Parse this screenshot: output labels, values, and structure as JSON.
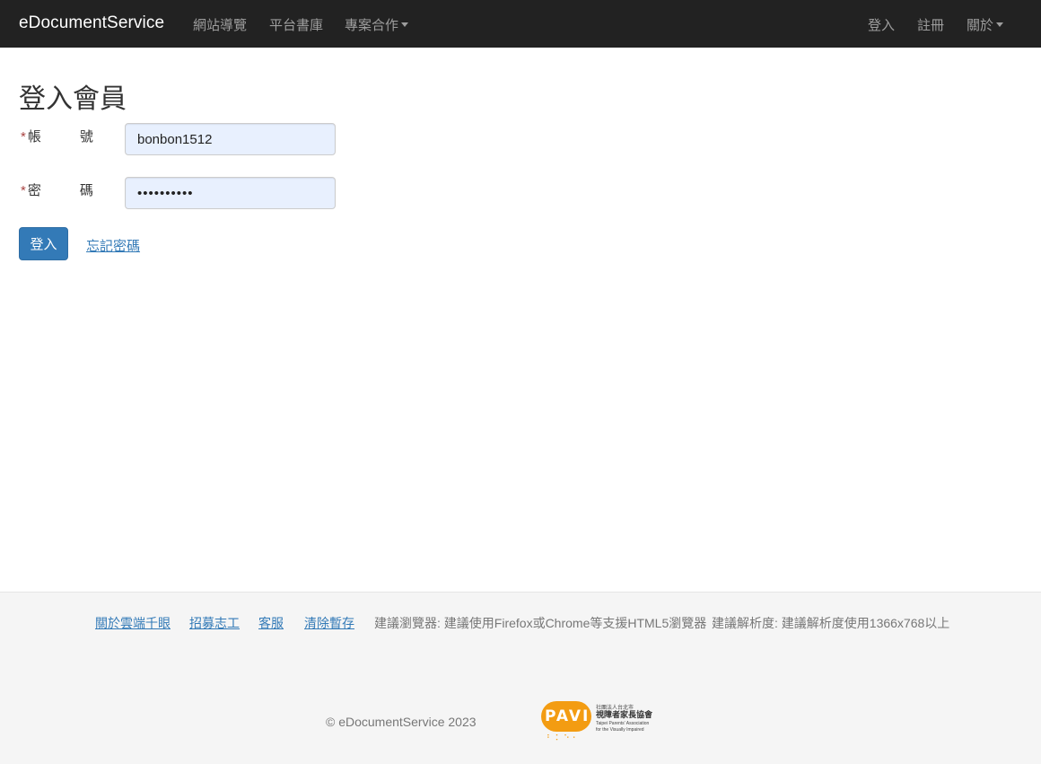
{
  "navbar": {
    "brand": "eDocumentService",
    "left_items": [
      "網站導覽",
      "平台書庫",
      "專案合作"
    ],
    "right_items": [
      "登入",
      "註冊",
      "關於"
    ]
  },
  "page": {
    "title": "登入會員"
  },
  "form": {
    "required_mark": "*",
    "account": {
      "label_a": "帳",
      "label_b": "號",
      "value": "bonbon1512"
    },
    "password": {
      "label_a": "密",
      "label_b": "碼",
      "value": "••••••••••"
    },
    "login_button": "登入",
    "forgot_link": "忘記密碼"
  },
  "footer": {
    "links": [
      "關於雲端千眼",
      "招募志工",
      "客服",
      "清除暫存"
    ],
    "browser_note": "建議瀏覽器: 建議使用Firefox或Chrome等支援HTML5瀏覽器",
    "resolution_note": "建議解析度: 建議解析度使用1366x768以上",
    "copyright": "© eDocumentService 2023",
    "logo": {
      "letters": "PAVI",
      "org_top": "社團法人台北市",
      "org_name": "視障者家長協會",
      "org_en_1": "Taipei Parents' Association",
      "org_en_2": "for the Visually Impaired"
    }
  }
}
